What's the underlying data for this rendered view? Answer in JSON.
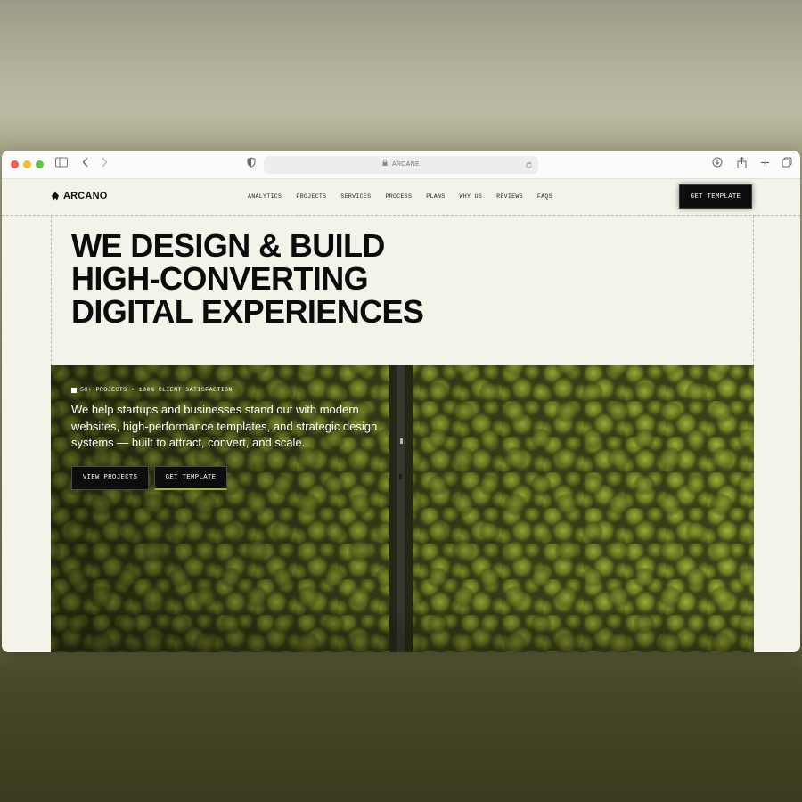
{
  "browser": {
    "address": "ARCANE",
    "icons": [
      "sidebar-icon",
      "back-icon",
      "forward-icon",
      "shield-icon",
      "lock-icon",
      "reload-icon",
      "download-icon",
      "share-icon",
      "new-tab-icon",
      "tabs-icon"
    ]
  },
  "site": {
    "logo": "ARCANO",
    "nav": [
      "ANALYTICS",
      "PROJECTS",
      "SERVICES",
      "PROCESS",
      "PLANS",
      "WHY US",
      "REVIEWS",
      "FAQS"
    ],
    "cta": "GET TEMPLATE",
    "headline": "WE DESIGN & BUILD\nHIGH-CONVERTING\nDIGITAL EXPERIENCES",
    "hero": {
      "badge": "50+ PROJECTS • 100% CLIENT SATISFACTION",
      "text": "We help startups and businesses stand out with modern websites, high-performance templates, and strategic design systems — built to attract, convert, and scale.",
      "buttons": {
        "primary": "VIEW PROJECTS",
        "secondary": "GET TEMPLATE"
      }
    }
  },
  "colors": {
    "page_bg": "#f4f3ea",
    "button_bg": "#0d0d0d",
    "accent_green": "#9bbd2e",
    "forest_dark": "#3c4418",
    "forest_light": "#8a9a2c"
  }
}
